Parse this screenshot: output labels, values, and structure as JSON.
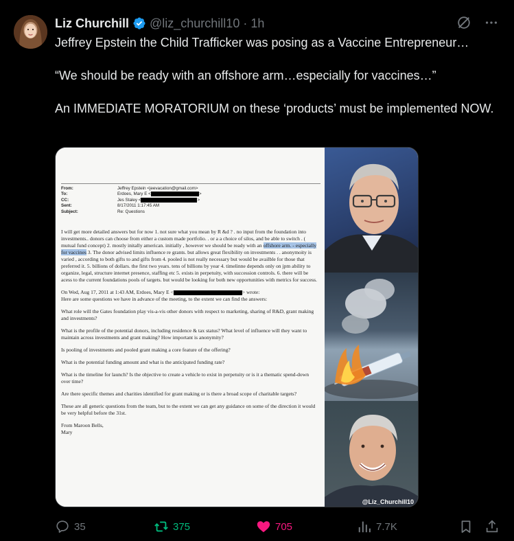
{
  "author": {
    "display_name": "Liz Churchill",
    "handle": "@liz_churchill10",
    "separator": "·",
    "time": "1h",
    "verified": true
  },
  "post": {
    "line1": "Jeffrey Epstein the Child Trafficker was posing as a Vaccine Entrepreneur…",
    "line2": "“We should be ready with an offshore arm…especially for vaccines…”",
    "line3": "An IMMEDIATE MORATORIUM on these ‘products’ must be implemented NOW."
  },
  "document": {
    "header": {
      "from_k": "From:",
      "from_v": "Jeffrey Epstein <jeevacation@gmail.com>",
      "to_k": "To:",
      "to_v": "Erdoes, Mary E <",
      "cc_k": "CC:",
      "cc_v": "Jes Staley <",
      "sent_k": "Sent:",
      "sent_v": "8/17/2011 1:17:45 AM",
      "subject_k": "Subject:",
      "subject_v": "Re: Questions"
    },
    "p1a": "I will get more detailed answers but for now   1. not sure what you mean by R &d ? . no input from the foundation into investments.. donors can choose from either a custom made portfolio. . or a a choice of silos, and be able to switch . ( mutual fund concept) 2. mostly initally american.  initially , however we should be ready with an ",
    "p1_highlight": "offshore arm. - especially for vaccines",
    "p1b": " 3. The donor advised limits influence re grants. but allows great flexibility on investments . . anonymoity is varied  , according to both gifts to and gifts from   4. pooled is not really necessary but would be availble for those that preferred it. 5. billions of dollars. the first two years.  tens of billions by year 4.  timelinne depends only on jpm ability to organize, legal, structure internet presence, staffing etc 5. exists in perpetuity, with succession controls. 6. there will be acess to the current foundations pools of targets. but would be looking for both new opportunities with metrics for success.",
    "p2a": "On Wed, Aug 17, 2011 at 1:43 AM, Erdoes, Mary E <",
    "p2b": "> wrote:",
    "p2c": "Here are some questions we have in advance of the meeting, to the extent we can find the answers:",
    "q1": "What role will the Gates foundation play vis-a-vis other donors with respect to marketing, sharing of R&D, grant making and investments?",
    "q2": "What is the profile of the potential donors, including residence & tax status?  What level of influence will they want to maintain across investments and grant making? How important is anonymity?",
    "q3": "Is pooling of investments and pooled grant making a core feature of the offering?",
    "q4": "What is the potential funding amount and what is the anticipated funding rate?",
    "q5": "What is the timeline for launch? Is the objective to create a vehicle to exist in perpetuity or is it a thematic spend-down over time?",
    "q6": "Are there specific themes and charities identified for grant making or is there a broad scope of charitable targets?",
    "q7": "These are all generic questions from the team, but to the extent we can get any guidance on some of the direction it would be very helpful before the 31st.",
    "sign1": "From Maroon Bells,",
    "sign2": "Mary"
  },
  "media": {
    "watermark": "@Liz_Churchill10"
  },
  "actions": {
    "replies": "35",
    "reposts": "375",
    "likes": "705",
    "views": "7.7K"
  },
  "icons": [
    "verified-badge-icon",
    "grok-icon",
    "more-icon",
    "reply-icon",
    "repost-icon",
    "like-icon",
    "views-icon",
    "bookmark-icon",
    "share-icon"
  ],
  "colors": {
    "background": "#000000",
    "text": "#e7e9ea",
    "muted": "#71767b",
    "verified": "#1d9bf0",
    "repost": "#00ba7c",
    "like": "#f91880"
  }
}
